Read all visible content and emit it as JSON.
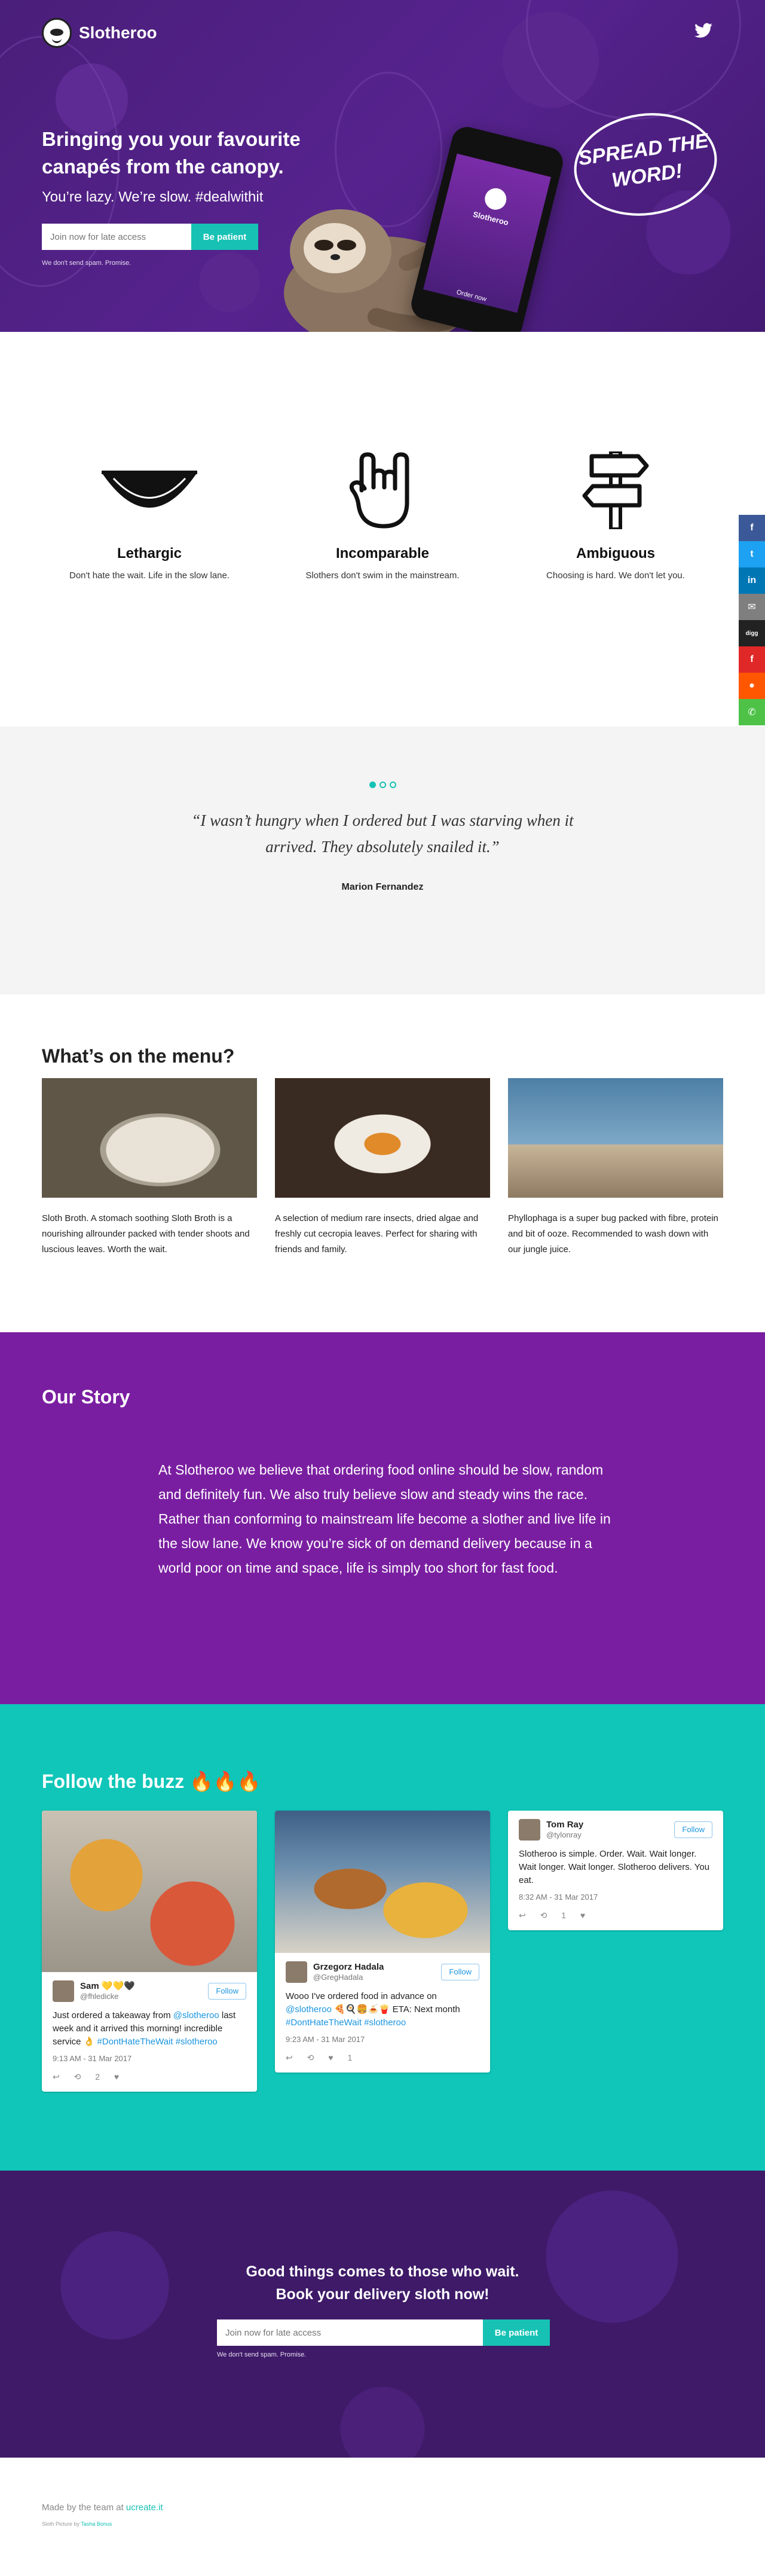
{
  "header": {
    "brand": "Slotheroo",
    "twitter_icon": "twitter-icon"
  },
  "hero": {
    "headline": "Bringing you your favourite canapés from the canopy.",
    "tagline": "You’re lazy. We’re slow. #dealwithit",
    "signup": {
      "placeholder": "Join now for late access",
      "button": "Be patient",
      "nospam": "We don't send spam. Promise."
    },
    "phone": {
      "brand": "Slotheroo",
      "cta": "Order now"
    },
    "bubble": "SPREAD THE WORD!"
  },
  "social_share": [
    {
      "icon": "facebook-icon",
      "glyph": "f",
      "color": "#3b5998"
    },
    {
      "icon": "twitter-icon",
      "glyph": "t",
      "color": "#1da1f2"
    },
    {
      "icon": "linkedin-icon",
      "glyph": "in",
      "color": "#0077b5"
    },
    {
      "icon": "email-icon",
      "glyph": "✉",
      "color": "#7f7f7f"
    },
    {
      "icon": "digg-icon",
      "glyph": "digg",
      "color": "#222222"
    },
    {
      "icon": "flipboard-icon",
      "glyph": "f",
      "color": "#e12828"
    },
    {
      "icon": "reddit-icon",
      "glyph": "●",
      "color": "#ff5700"
    },
    {
      "icon": "whatsapp-icon",
      "glyph": "✆",
      "color": "#4dc247"
    }
  ],
  "features": [
    {
      "icon": "hammock-icon",
      "title": "Lethargic",
      "text": "Don't hate the wait. Life in the slow lane."
    },
    {
      "icon": "rock-hand-icon",
      "title": "Incomparable",
      "text": "Slothers don't swim in the mainstream."
    },
    {
      "icon": "signpost-icon",
      "title": "Ambiguous",
      "text": "Choosing is hard. We don't let you."
    }
  ],
  "testimonial": {
    "quote": "“I wasn’t hungry when I ordered but I was starving when it arrived. They absolutely snailed it.”",
    "author": "Marion Fernandez"
  },
  "menu": {
    "title": "What’s on the menu?",
    "items": [
      {
        "text": "Sloth Broth. A stomach soothing Sloth Broth is a nourishing allrounder packed with tender shoots and luscious leaves. Worth the wait."
      },
      {
        "text": "A selection of medium rare insects, dried algae and freshly cut cecropia leaves. Perfect for sharing with friends and family."
      },
      {
        "text": "Phyllophaga is a super bug packed with fibre, protein and bit of ooze. Recommended to wash down with our jungle juice."
      }
    ]
  },
  "story": {
    "title": "Our Story",
    "text": "At Slotheroo we believe that ordering food online should be slow, random and definitely fun. We also truly believe slow and steady wins the race. Rather than conforming to mainstream life become a slother and live life in the slow lane. We know you’re sick of on demand delivery because in a world poor on time and space, life is simply too short for fast food."
  },
  "buzz": {
    "title": "Follow the buzz 🔥🔥🔥",
    "follow": "Follow",
    "tweets": [
      {
        "name": "Sam 💛💛🖤",
        "handle": "@fhledicke",
        "text": "Just ordered a takeaway from",
        "link": "@slotheroo",
        "text2": " last week and it arrived this morning! incredible service 👌",
        "tag": "#DontHateTheWait #slotheroo",
        "date": "9:13 AM - 31 Mar 2017",
        "counts": "↩  ⟲ 2  ♥"
      },
      {
        "name": "Grzegorz Hadala",
        "handle": "@GregHadala",
        "text": "Wooo I've ordered food in advance on",
        "link": "@slotheroo",
        "text2": " 🍕🍳🍔🍝🍟 ETA: Next month",
        "tag": "#DontHateTheWait #slotheroo",
        "date": "9:23 AM - 31 Mar 2017",
        "counts": "↩  ⟲  ♥ 1"
      },
      {
        "name": "Tom Ray",
        "handle": "@tylonray",
        "text": "Slotheroo is simple. Order. Wait. Wait longer. Wait longer. Wait longer. Slotheroo delivers. You eat.",
        "link": "",
        "text2": "",
        "tag": "",
        "date": "8:32 AM - 31 Mar 2017",
        "counts": "↩  ⟲ 1  ♥"
      }
    ]
  },
  "cta": {
    "headline": "Good things comes to those who wait.",
    "headline2": "Book your delivery sloth now!"
  },
  "footer": {
    "made": "Made by the team at ",
    "made_link": "ucreate.it",
    "small": "Sloth Picture by ",
    "small_link": "Tasha Bonus"
  }
}
